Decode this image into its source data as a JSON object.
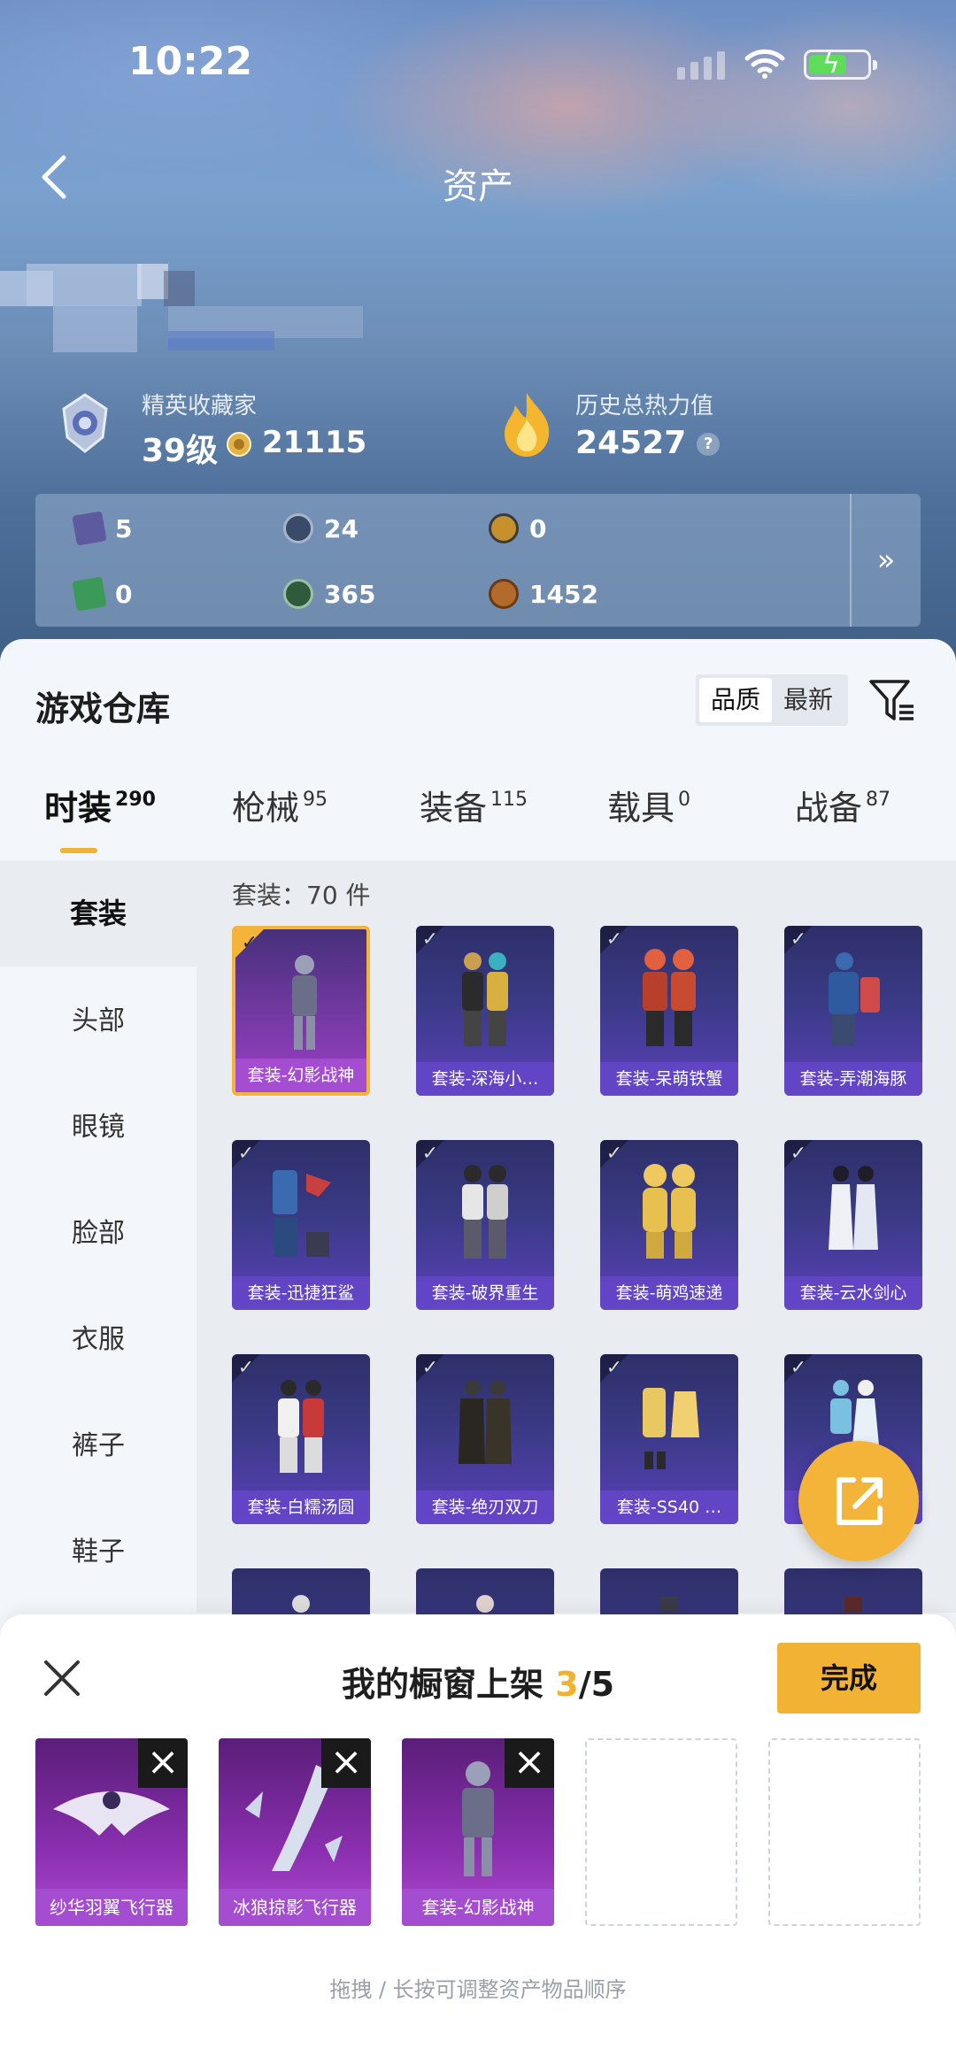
{
  "status": {
    "time": "10:22"
  },
  "header": {
    "title": "资产"
  },
  "profile": {
    "rank_label": "精英收藏家",
    "level": "39级",
    "points": "21115",
    "power_label": "历史总热力值",
    "power_value": "24527",
    "help": "?"
  },
  "resources": [
    {
      "value": "5",
      "icon": "card-icon",
      "color": "#5e5aa0"
    },
    {
      "value": "24",
      "icon": "coin-s-icon",
      "color": "#3a4b6a"
    },
    {
      "value": "0",
      "icon": "coin-a-icon",
      "color": "#c6902c"
    },
    {
      "value": "0",
      "icon": "ticket-icon",
      "color": "#3b9a58"
    },
    {
      "value": "365",
      "icon": "gem-icon",
      "color": "#2f5a3c"
    },
    {
      "value": "1452",
      "icon": "bronze-coin-icon",
      "color": "#b26b2a"
    }
  ],
  "resources_more": "»",
  "warehouse": {
    "title": "游戏仓库",
    "sort_quality": "品质",
    "sort_latest": "最新",
    "tabs": [
      {
        "label": "时装",
        "count": "290"
      },
      {
        "label": "枪械",
        "count": "95"
      },
      {
        "label": "装备",
        "count": "115"
      },
      {
        "label": "载具",
        "count": "0"
      },
      {
        "label": "战备",
        "count": "87"
      }
    ],
    "categories": [
      "套装",
      "头部",
      "眼镜",
      "脸部",
      "衣服",
      "裤子",
      "鞋子"
    ],
    "grid_header": "套装：70 件",
    "items": [
      "套装-幻影战神",
      "套装-深海小…",
      "套装-呆萌铁蟹",
      "套装-弄潮海豚",
      "套装-迅捷狂鲨",
      "套装-破界重生",
      "套装-萌鸡速递",
      "套装-云水剑心",
      "套装-白糯汤圆",
      "套装-绝刃双刀",
      "套装-SS40 …",
      ""
    ]
  },
  "showcase": {
    "title": "我的橱窗上架",
    "count_current": "3",
    "count_total": "/5",
    "done": "完成",
    "slots": [
      "纱华羽翼飞行器",
      "冰狼掠影飞行器",
      "套装-幻影战神"
    ],
    "hint": "拖拽 / 长按可调整资产物品顺序"
  }
}
